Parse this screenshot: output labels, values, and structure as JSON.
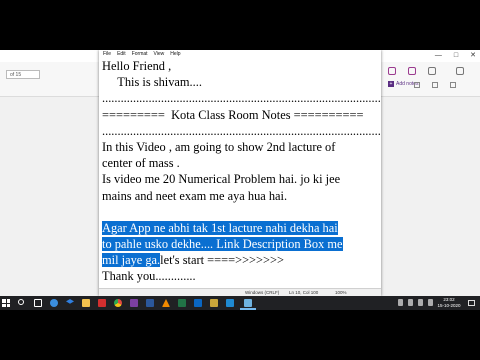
{
  "notepad": {
    "menu": [
      "File",
      "Edit",
      "Format",
      "View",
      "Help"
    ],
    "lines": [
      [
        {
          "text": "Hello Friend ,",
          "selected": false
        }
      ],
      [
        {
          "text": "     This is shivam....",
          "selected": false
        }
      ],
      [
        {
          "text": "................................................................................................................................",
          "selected": false
        }
      ],
      [
        {
          "text": "=========  Kota Class Room Notes ==========",
          "selected": false
        }
      ],
      [
        {
          "text": "................................................................................................................................",
          "selected": false
        }
      ],
      [
        {
          "text": "In this Video , am going to show 2nd lacture of",
          "selected": false
        }
      ],
      [
        {
          "text": "center of mass .",
          "selected": false
        }
      ],
      [
        {
          "text": "Is video me 20 Numerical Problem hai. jo ki jee",
          "selected": false
        }
      ],
      [
        {
          "text": "mains and neet exam me aya hua hai.",
          "selected": false
        }
      ],
      [
        {
          "text": "",
          "selected": false
        }
      ],
      [
        {
          "text": "Agar App ne abhi tak 1st lacture nahi dekha hai",
          "selected": true
        }
      ],
      [
        {
          "text": "to pahle usko dekhe.... Link Description Box me",
          "selected": true
        }
      ],
      [
        {
          "text": "mil jaye ga.",
          "selected": true
        },
        {
          "text": "let's start ====>>>>>>>",
          "selected": false
        }
      ],
      [
        {
          "text": "Thank you.............",
          "selected": false
        }
      ]
    ],
    "status": {
      "encoding": "Windows (CRLF)",
      "position": "Ln 10, Col 100",
      "zoom": "100%"
    }
  },
  "background_app": {
    "page_counter": "of 15",
    "add_notes_label": "Add notes",
    "accent_color": "#5a2d82"
  },
  "taskbar": {
    "clock_time": "23:02",
    "clock_date": "15-10-2020",
    "pinned_icons": [
      "search-icon",
      "task-view-icon",
      "edge-icon",
      "dropbox-icon",
      "file-explorer-icon",
      "acrobat-icon",
      "chrome-icon",
      "onenote-icon",
      "word-icon",
      "vlc-icon",
      "excel-icon",
      "linkedin-icon",
      "files-icon",
      "vscode-icon",
      "notepad-icon"
    ]
  },
  "selection_color": "#0a6fd1"
}
